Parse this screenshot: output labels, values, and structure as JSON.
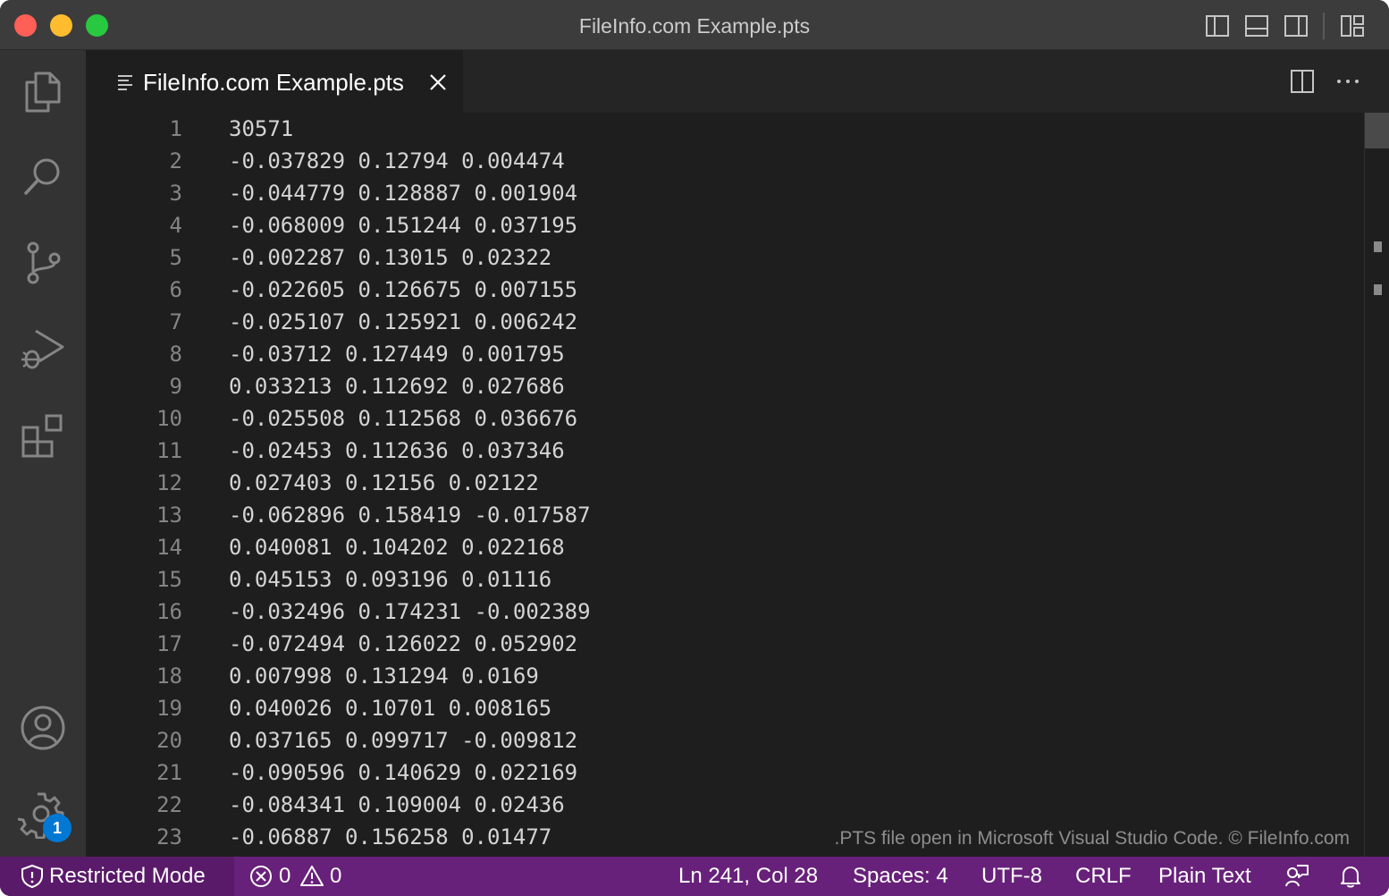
{
  "window": {
    "title": "FileInfo.com Example.pts"
  },
  "tab": {
    "label": "FileInfo.com Example.pts"
  },
  "editor": {
    "lines": [
      {
        "number": "1",
        "text": "30571"
      },
      {
        "number": "2",
        "text": "-0.037829 0.12794 0.004474"
      },
      {
        "number": "3",
        "text": "-0.044779 0.128887 0.001904"
      },
      {
        "number": "4",
        "text": "-0.068009 0.151244 0.037195"
      },
      {
        "number": "5",
        "text": "-0.002287 0.13015 0.02322"
      },
      {
        "number": "6",
        "text": "-0.022605 0.126675 0.007155"
      },
      {
        "number": "7",
        "text": "-0.025107 0.125921 0.006242"
      },
      {
        "number": "8",
        "text": "-0.03712 0.127449 0.001795"
      },
      {
        "number": "9",
        "text": "0.033213 0.112692 0.027686"
      },
      {
        "number": "10",
        "text": "-0.025508 0.112568 0.036676"
      },
      {
        "number": "11",
        "text": "-0.02453 0.112636 0.037346"
      },
      {
        "number": "12",
        "text": "0.027403 0.12156 0.02122"
      },
      {
        "number": "13",
        "text": "-0.062896 0.158419 -0.017587"
      },
      {
        "number": "14",
        "text": "0.040081 0.104202 0.022168"
      },
      {
        "number": "15",
        "text": "0.045153 0.093196 0.01116"
      },
      {
        "number": "16",
        "text": "-0.032496 0.174231 -0.002389"
      },
      {
        "number": "17",
        "text": "-0.072494 0.126022 0.052902"
      },
      {
        "number": "18",
        "text": "0.007998 0.131294 0.0169"
      },
      {
        "number": "19",
        "text": "0.040026 0.10701 0.008165"
      },
      {
        "number": "20",
        "text": "0.037165 0.099717 -0.009812"
      },
      {
        "number": "21",
        "text": "-0.090596 0.140629 0.022169"
      },
      {
        "number": "22",
        "text": "-0.084341 0.109004 0.02436"
      },
      {
        "number": "23",
        "text": "-0.06887 0.156258 0.01477"
      }
    ],
    "watermark": ".PTS file open in Microsoft Visual Studio Code. © FileInfo.com"
  },
  "activitybar": {
    "settings_badge": "1"
  },
  "statusbar": {
    "restricted_mode": "Restricted Mode",
    "errors": "0",
    "warnings": "0",
    "cursor_position": "Ln 241, Col 28",
    "indentation": "Spaces: 4",
    "encoding": "UTF-8",
    "line_endings": "CRLF",
    "language_mode": "Plain Text"
  },
  "colors": {
    "statusbar_bg": "#68217a",
    "badge_bg": "#0078d4",
    "editor_bg": "#1e1e1e",
    "titlebar_bg": "#3c3c3c"
  }
}
